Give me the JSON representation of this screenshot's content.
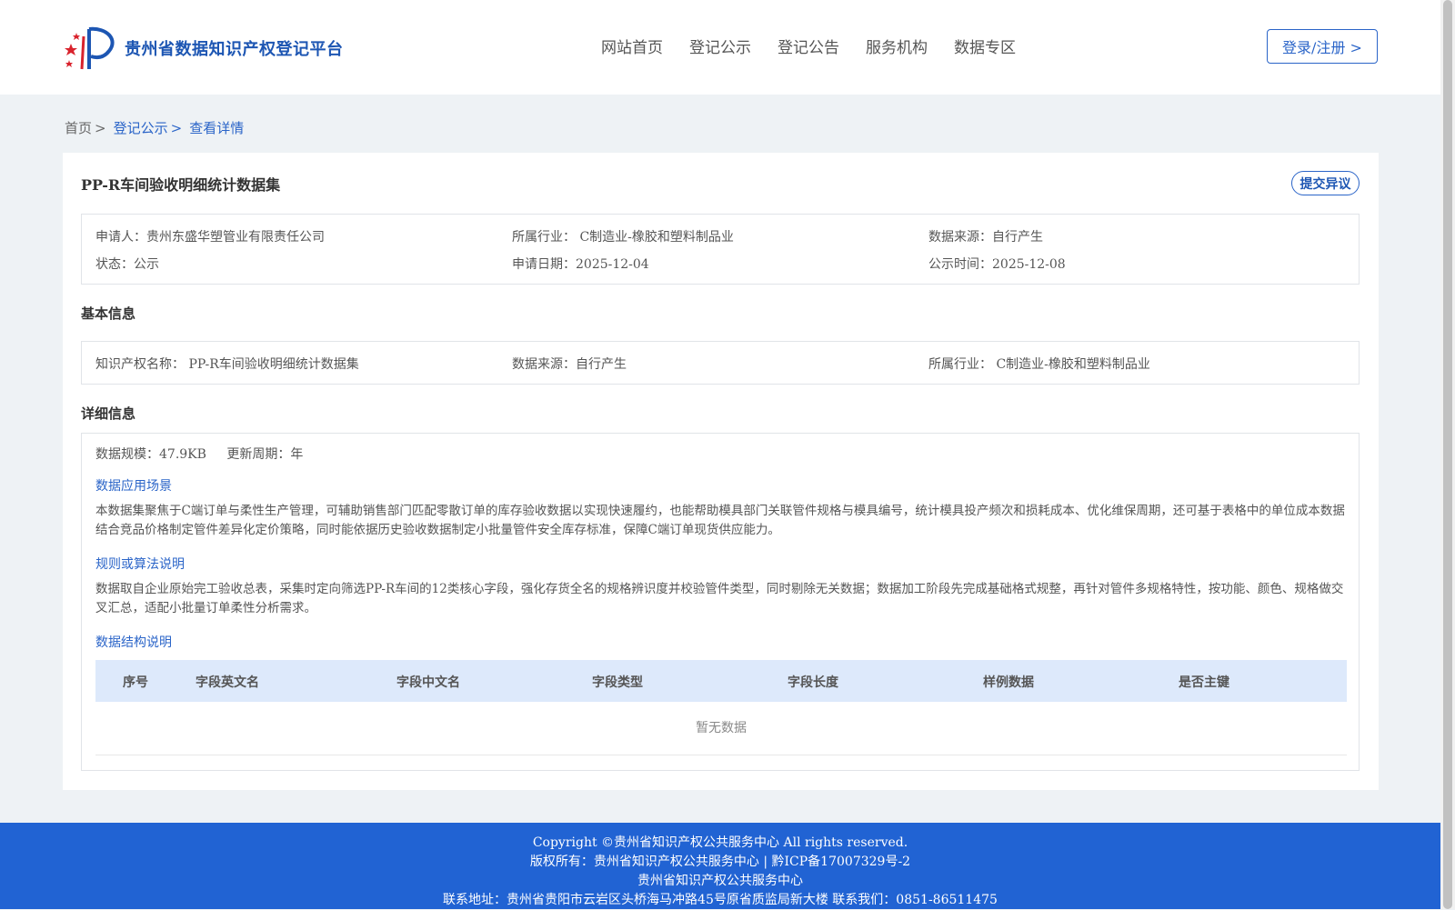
{
  "header": {
    "site_title": "贵州省数据知识产权登记平台",
    "nav": [
      "网站首页",
      "登记公示",
      "登记公告",
      "服务机构",
      "数据专区"
    ],
    "login_label": "登录/注册 >"
  },
  "breadcrumb": {
    "home": "首页",
    "level1": "登记公示",
    "current": "查看详情",
    "sep": ">"
  },
  "detail": {
    "title": "PP-R车间验收明细统计数据集",
    "objection_label": "提交异议",
    "summary": {
      "applicant_label": "申请人：",
      "applicant": "贵州东盛华塑管业有限责任公司",
      "industry_label": "所属行业：",
      "industry": "C制造业-橡胶和塑料制品业",
      "source_label": "数据来源：",
      "source": "自行产生",
      "status_label": "状态：",
      "status": "公示",
      "apply_date_label": "申请日期：",
      "apply_date": "2025-12-04",
      "publish_date_label": "公示时间：",
      "publish_date": "2025-12-08"
    },
    "basic": {
      "section_title": "基本信息",
      "name_label": "知识产权名称：",
      "name": "PP-R车间验收明细统计数据集",
      "source_label": "数据来源：",
      "source": "自行产生",
      "industry_label": "所属行业：",
      "industry": "C制造业-橡胶和塑料制品业"
    },
    "more": {
      "section_title": "详细信息",
      "scale_label": "数据规模：",
      "scale": "47.9KB",
      "cycle_label": "更新周期：",
      "cycle": "年",
      "scenario_title": "数据应用场景",
      "scenario_text": "本数据集聚焦于C端订单与柔性生产管理，可辅助销售部门匹配零散订单的库存验收数据以实现快速履约，也能帮助模具部门关联管件规格与模具编号，统计模具投产频次和损耗成本、优化维保周期，还可基于表格中的单位成本数据结合竞品价格制定管件差异化定价策略，同时能依据历史验收数据制定小批量管件安全库存标准，保障C端订单现货供应能力。",
      "rules_title": "规则或算法说明",
      "rules_text": "数据取自企业原始完工验收总表，采集时定向筛选PP-R车间的12类核心字段，强化存货全名的规格辨识度并校验管件类型，同时剔除无关数据；数据加工阶段先完成基础格式规整，再针对管件多规格特性，按功能、颜色、规格做交叉汇总，适配小批量订单柔性分析需求。",
      "structure_title": "数据结构说明",
      "table_headers": [
        "序号",
        "字段英文名",
        "字段中文名",
        "字段类型",
        "字段长度",
        "样例数据",
        "是否主键"
      ],
      "empty_text": "暂无数据"
    }
  },
  "footer": {
    "line1": "Copyright ©贵州省知识产权公共服务中心 All rights reserved.",
    "line2": "版权所有：贵州省知识产权公共服务中心 | 黔ICP备17007329号-2",
    "line3": "贵州省知识产权公共服务中心",
    "line4": "联系地址：贵州省贵阳市云岩区头桥海马冲路45号原省质监局新大楼 联系我们：0851-86511475"
  },
  "colors": {
    "primary": "#2a64c8",
    "footer_bg": "#2163d3",
    "page_bg": "#eef2f5",
    "table_header_bg": "#dde9fb"
  }
}
